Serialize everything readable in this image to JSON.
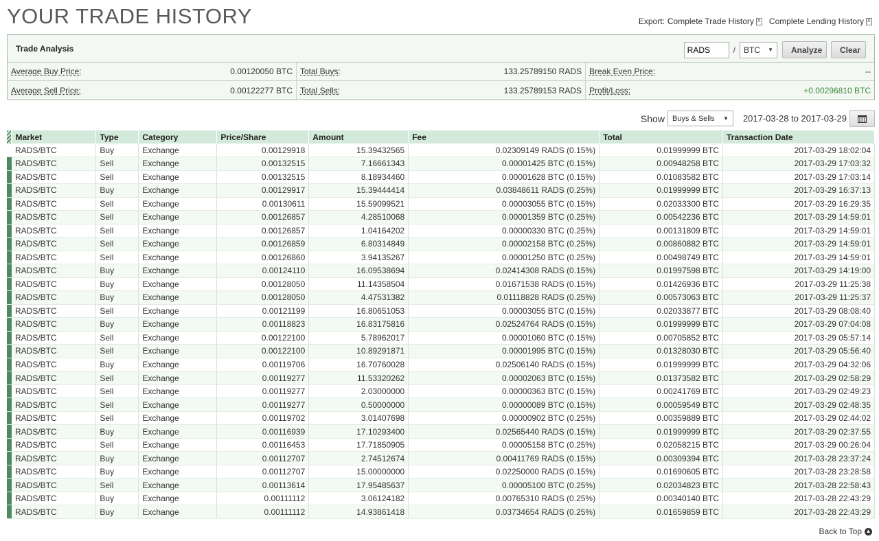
{
  "page_title": "YOUR TRADE HISTORY",
  "export": {
    "label": "Export:",
    "complete_trade_history": "Complete Trade History",
    "complete_lending_history": "Complete Lending History"
  },
  "analysis": {
    "title": "Trade Analysis",
    "coin_value": "RADS",
    "separator": "/",
    "market_value": "BTC",
    "analyze_label": "Analyze",
    "clear_label": "Clear",
    "stats": {
      "avg_buy_label": "Average Buy Price:",
      "avg_buy_value": "0.00120050 BTC",
      "total_buys_label": "Total Buys:",
      "total_buys_value": "133.25789150 RADS",
      "break_even_label": "Break Even Price:",
      "break_even_value": "--",
      "avg_sell_label": "Average Sell Price:",
      "avg_sell_value": "0.00122277 BTC",
      "total_sells_label": "Total Sells:",
      "total_sells_value": "133.25789153 RADS",
      "profit_loss_label": "Profit/Loss:",
      "profit_loss_value": "+0.00296810 BTC"
    }
  },
  "filter": {
    "show_label": "Show",
    "show_value": "Buys & Sells",
    "date_range": "2017-03-28 to 2017-03-29"
  },
  "table": {
    "headers": {
      "market": "Market",
      "type": "Type",
      "category": "Category",
      "price": "Price/Share",
      "amount": "Amount",
      "fee": "Fee",
      "total": "Total",
      "date": "Transaction Date"
    },
    "rows": [
      {
        "market": "RADS/BTC",
        "type": "Buy",
        "category": "Exchange",
        "price": "0.00129918",
        "amount": "15.39432565",
        "fee": "0.02309149 RADS (0.15%)",
        "total": "0.01999999 BTC",
        "date": "2017-03-29 18:02:04"
      },
      {
        "market": "RADS/BTC",
        "type": "Sell",
        "category": "Exchange",
        "price": "0.00132515",
        "amount": "7.16661343",
        "fee": "0.00001425 BTC (0.15%)",
        "total": "0.00948258 BTC",
        "date": "2017-03-29 17:03:32"
      },
      {
        "market": "RADS/BTC",
        "type": "Sell",
        "category": "Exchange",
        "price": "0.00132515",
        "amount": "8.18934460",
        "fee": "0.00001628 BTC (0.15%)",
        "total": "0.01083582 BTC",
        "date": "2017-03-29 17:03:14"
      },
      {
        "market": "RADS/BTC",
        "type": "Buy",
        "category": "Exchange",
        "price": "0.00129917",
        "amount": "15.39444414",
        "fee": "0.03848611 RADS (0.25%)",
        "total": "0.01999999 BTC",
        "date": "2017-03-29 16:37:13"
      },
      {
        "market": "RADS/BTC",
        "type": "Sell",
        "category": "Exchange",
        "price": "0.00130611",
        "amount": "15.59099521",
        "fee": "0.00003055 BTC (0.15%)",
        "total": "0.02033300 BTC",
        "date": "2017-03-29 16:29:35"
      },
      {
        "market": "RADS/BTC",
        "type": "Sell",
        "category": "Exchange",
        "price": "0.00126857",
        "amount": "4.28510068",
        "fee": "0.00001359 BTC (0.25%)",
        "total": "0.00542236 BTC",
        "date": "2017-03-29 14:59:01"
      },
      {
        "market": "RADS/BTC",
        "type": "Sell",
        "category": "Exchange",
        "price": "0.00126857",
        "amount": "1.04164202",
        "fee": "0.00000330 BTC (0.25%)",
        "total": "0.00131809 BTC",
        "date": "2017-03-29 14:59:01"
      },
      {
        "market": "RADS/BTC",
        "type": "Sell",
        "category": "Exchange",
        "price": "0.00126859",
        "amount": "6.80314849",
        "fee": "0.00002158 BTC (0.25%)",
        "total": "0.00860882 BTC",
        "date": "2017-03-29 14:59:01"
      },
      {
        "market": "RADS/BTC",
        "type": "Sell",
        "category": "Exchange",
        "price": "0.00126860",
        "amount": "3.94135267",
        "fee": "0.00001250 BTC (0.25%)",
        "total": "0.00498749 BTC",
        "date": "2017-03-29 14:59:01"
      },
      {
        "market": "RADS/BTC",
        "type": "Buy",
        "category": "Exchange",
        "price": "0.00124110",
        "amount": "16.09538694",
        "fee": "0.02414308 RADS (0.15%)",
        "total": "0.01997598 BTC",
        "date": "2017-03-29 14:19:00"
      },
      {
        "market": "RADS/BTC",
        "type": "Buy",
        "category": "Exchange",
        "price": "0.00128050",
        "amount": "11.14358504",
        "fee": "0.01671538 RADS (0.15%)",
        "total": "0.01426936 BTC",
        "date": "2017-03-29 11:25:38"
      },
      {
        "market": "RADS/BTC",
        "type": "Buy",
        "category": "Exchange",
        "price": "0.00128050",
        "amount": "4.47531382",
        "fee": "0.01118828 RADS (0.25%)",
        "total": "0.00573063 BTC",
        "date": "2017-03-29 11:25:37"
      },
      {
        "market": "RADS/BTC",
        "type": "Sell",
        "category": "Exchange",
        "price": "0.00121199",
        "amount": "16.80651053",
        "fee": "0.00003055 BTC (0.15%)",
        "total": "0.02033877 BTC",
        "date": "2017-03-29 08:08:40"
      },
      {
        "market": "RADS/BTC",
        "type": "Buy",
        "category": "Exchange",
        "price": "0.00118823",
        "amount": "16.83175816",
        "fee": "0.02524764 RADS (0.15%)",
        "total": "0.01999999 BTC",
        "date": "2017-03-29 07:04:08"
      },
      {
        "market": "RADS/BTC",
        "type": "Sell",
        "category": "Exchange",
        "price": "0.00122100",
        "amount": "5.78962017",
        "fee": "0.00001060 BTC (0.15%)",
        "total": "0.00705852 BTC",
        "date": "2017-03-29 05:57:14"
      },
      {
        "market": "RADS/BTC",
        "type": "Sell",
        "category": "Exchange",
        "price": "0.00122100",
        "amount": "10.89291871",
        "fee": "0.00001995 BTC (0.15%)",
        "total": "0.01328030 BTC",
        "date": "2017-03-29 05:56:40"
      },
      {
        "market": "RADS/BTC",
        "type": "Buy",
        "category": "Exchange",
        "price": "0.00119706",
        "amount": "16.70760028",
        "fee": "0.02506140 RADS (0.15%)",
        "total": "0.01999999 BTC",
        "date": "2017-03-29 04:32:06"
      },
      {
        "market": "RADS/BTC",
        "type": "Sell",
        "category": "Exchange",
        "price": "0.00119277",
        "amount": "11.53320262",
        "fee": "0.00002063 BTC (0.15%)",
        "total": "0.01373582 BTC",
        "date": "2017-03-29 02:58:29"
      },
      {
        "market": "RADS/BTC",
        "type": "Sell",
        "category": "Exchange",
        "price": "0.00119277",
        "amount": "2.03000000",
        "fee": "0.00000363 BTC (0.15%)",
        "total": "0.00241769 BTC",
        "date": "2017-03-29 02:49:23"
      },
      {
        "market": "RADS/BTC",
        "type": "Sell",
        "category": "Exchange",
        "price": "0.00119277",
        "amount": "0.50000000",
        "fee": "0.00000089 BTC (0.15%)",
        "total": "0.00059549 BTC",
        "date": "2017-03-29 02:48:35"
      },
      {
        "market": "RADS/BTC",
        "type": "Sell",
        "category": "Exchange",
        "price": "0.00119702",
        "amount": "3.01407698",
        "fee": "0.00000902 BTC (0.25%)",
        "total": "0.00359889 BTC",
        "date": "2017-03-29 02:44:02"
      },
      {
        "market": "RADS/BTC",
        "type": "Buy",
        "category": "Exchange",
        "price": "0.00116939",
        "amount": "17.10293400",
        "fee": "0.02565440 RADS (0.15%)",
        "total": "0.01999999 BTC",
        "date": "2017-03-29 02:37:55"
      },
      {
        "market": "RADS/BTC",
        "type": "Sell",
        "category": "Exchange",
        "price": "0.00116453",
        "amount": "17.71850905",
        "fee": "0.00005158 BTC (0.25%)",
        "total": "0.02058215 BTC",
        "date": "2017-03-29 00:26:04"
      },
      {
        "market": "RADS/BTC",
        "type": "Buy",
        "category": "Exchange",
        "price": "0.00112707",
        "amount": "2.74512674",
        "fee": "0.00411769 RADS (0.15%)",
        "total": "0.00309394 BTC",
        "date": "2017-03-28 23:37:24"
      },
      {
        "market": "RADS/BTC",
        "type": "Buy",
        "category": "Exchange",
        "price": "0.00112707",
        "amount": "15.00000000",
        "fee": "0.02250000 RADS (0.15%)",
        "total": "0.01690605 BTC",
        "date": "2017-03-28 23:28:58"
      },
      {
        "market": "RADS/BTC",
        "type": "Sell",
        "category": "Exchange",
        "price": "0.00113614",
        "amount": "17.95485637",
        "fee": "0.00005100 BTC (0.25%)",
        "total": "0.02034823 BTC",
        "date": "2017-03-28 22:58:43"
      },
      {
        "market": "RADS/BTC",
        "type": "Buy",
        "category": "Exchange",
        "price": "0.00111112",
        "amount": "3.06124182",
        "fee": "0.00765310 RADS (0.25%)",
        "total": "0.00340140 BTC",
        "date": "2017-03-28 22:43:29"
      },
      {
        "market": "RADS/BTC",
        "type": "Buy",
        "category": "Exchange",
        "price": "0.00111112",
        "amount": "14.93861418",
        "fee": "0.03734654 RADS (0.25%)",
        "total": "0.01659859 BTC",
        "date": "2017-03-28 22:43:29"
      }
    ]
  },
  "footer": {
    "back_to_top": "Back to Top"
  },
  "colors": {
    "buy": "#3c8f3c",
    "sell": "#c0392b",
    "header_bg": "#d3e9d9",
    "marker": "#4e8a5d"
  }
}
